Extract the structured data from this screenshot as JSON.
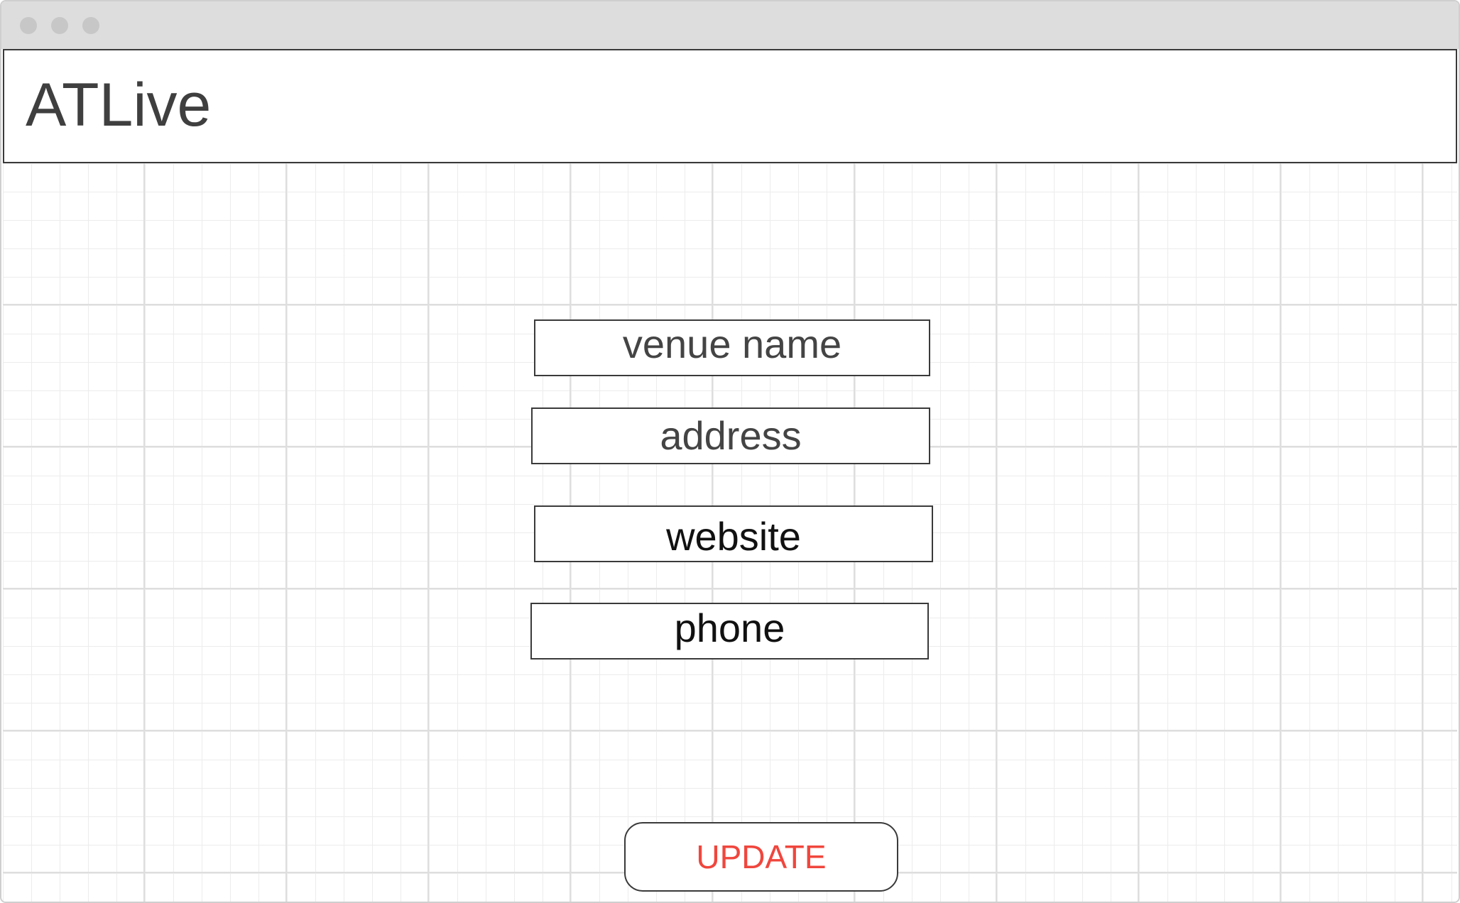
{
  "window": {
    "controls": [
      "close-dot",
      "minimize-dot",
      "maximize-dot"
    ]
  },
  "header": {
    "app_title": "ATLive"
  },
  "form": {
    "fields": {
      "venue_name": "venue name",
      "address": "address",
      "website": "website",
      "phone": "phone"
    },
    "update_label": "UPDATE"
  },
  "colors": {
    "titlebar": "#dddddd",
    "border": "#3a3a3a",
    "button_text": "#f0463d",
    "grid": "#e6e6e6"
  }
}
